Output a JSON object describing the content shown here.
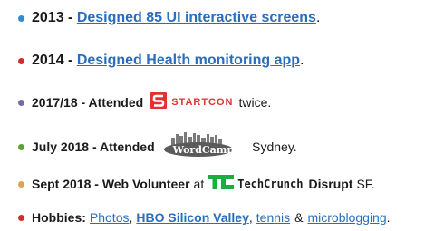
{
  "items": [
    {
      "year": "2013",
      "sep": " - ",
      "link": "Designed 85 UI interactive screens",
      "end": ".",
      "bullet_color": "#2e8dd6"
    },
    {
      "year": "2014",
      "sep": " - ",
      "link": "Designed Health monitoring app",
      "end": ".",
      "bullet_color": "#d42a2a"
    },
    {
      "lead": "2017/18 - Attended",
      "logo_text": "STARTCON",
      "logo_icon": "startcon-logo-icon",
      "tail": "twice.",
      "bullet_color": "#7b68a8"
    },
    {
      "lead": "July 2018 - Attended",
      "logo_text": "WordCamp",
      "logo_icon": "wordcamp-logo-icon",
      "tail": "Sydney.",
      "bullet_color": "#58a52e"
    },
    {
      "lead": "Sept 2018 - Web Volunteer",
      "at": "at",
      "logo_text": "TechCrunch",
      "logo_icon": "techcrunch-logo-icon",
      "event": "Disrupt",
      "tail": "SF.",
      "bullet_color": "#e0a54a"
    },
    {
      "label": "Hobbies:",
      "links": [
        "Photos",
        "HBO Silicon Valley",
        "tennis",
        "microblogging"
      ],
      "comma": ",",
      "amp": "&",
      "end": ".",
      "bullet_color": "#d42a2a"
    }
  ],
  "colors": {
    "link": "#2a6ebb",
    "startcon_red": "#e2322e",
    "techcrunch_green": "#1aad40"
  }
}
